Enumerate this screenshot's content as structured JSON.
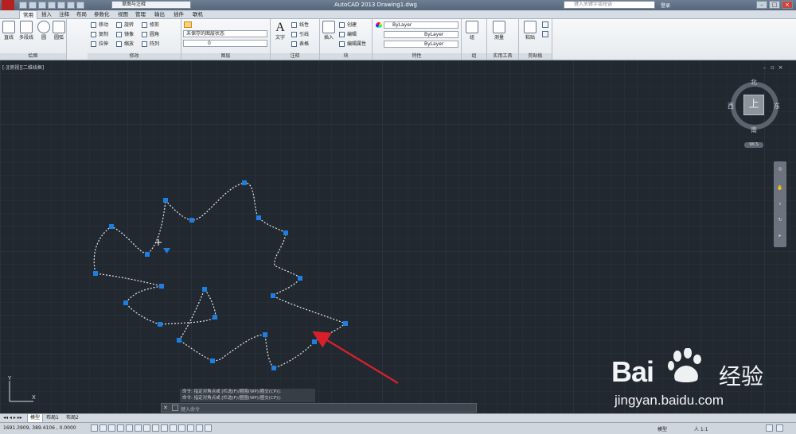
{
  "titlebar": {
    "workspace": "草图与注释",
    "app_title": "AutoCAD 2013    Drawing1.dwg",
    "search_placeholder": "键入关键字或短语",
    "login": "登录"
  },
  "ribbon_tabs": [
    "常用",
    "插入",
    "注释",
    "布局",
    "参数化",
    "视图",
    "管理",
    "输出",
    "插件",
    "联机"
  ],
  "ribbon": {
    "draw": {
      "title": "绘图",
      "line": "直线",
      "polyline": "多段线",
      "circle": "圆",
      "arc": "圆弧"
    },
    "modify": {
      "title": "修改",
      "move": "移动",
      "rotate": "旋转",
      "trim": "修剪",
      "copy": "复制",
      "mirror": "镜像",
      "fillet": "圆角",
      "stretch": "拉伸",
      "scale": "缩放",
      "array": "阵列"
    },
    "layers": {
      "title": "图层",
      "state": "未保存的图层状态",
      "current": "0"
    },
    "annotation": {
      "title": "注释",
      "text": "文字",
      "linear": "线性",
      "leader": "引线",
      "table": "表格"
    },
    "block": {
      "title": "块",
      "insert": "插入",
      "create": "创建",
      "edit": "编辑",
      "edit_attr": "编辑属性"
    },
    "properties": {
      "title": "特性",
      "color": "ByLayer",
      "linetype": "ByLayer",
      "lineweight": "ByLayer"
    },
    "groups": {
      "title": "组",
      "group": "组"
    },
    "utilities": {
      "title": "实用工具",
      "measure": "测量"
    },
    "clipboard": {
      "title": "剪贴板",
      "paste": "粘贴"
    }
  },
  "viewport": {
    "label": "[-][俯视][二维线框]",
    "viewcube": {
      "north": "北",
      "south": "南",
      "east": "东",
      "west": "西",
      "top": "上"
    },
    "wcs": "WCS"
  },
  "command": {
    "history_1": "命令: 指定对角点或 [栏选(F)/圈围(WP)/圈交(CP)]:",
    "history_2": "命令: 指定对角点或 [栏选(F)/圈围(WP)/圈交(CP)]:",
    "prompt": "键入命令"
  },
  "layout_tabs": [
    "模型",
    "布局1",
    "布局2"
  ],
  "status": {
    "coords": "1691.3909, 389.4106 , 0.0000",
    "model": "模型",
    "scale": "人 1:1"
  },
  "watermark": {
    "brand": "Bai",
    "brand_cn": "经验",
    "url": "jingyan.baidu.com"
  },
  "colors": {
    "canvas": "#212830",
    "grip": "#1e7fe0",
    "arrow": "#d9202a",
    "spline": "#e6e8ea"
  }
}
